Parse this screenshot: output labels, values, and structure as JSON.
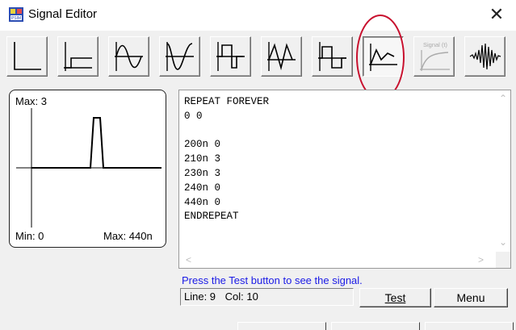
{
  "window": {
    "title": "Signal Editor",
    "close_glyph": "✕"
  },
  "toolbar": {
    "buttons": [
      {
        "icon": "step-icon",
        "pressed": false
      },
      {
        "icon": "offset-step-icon",
        "pressed": false
      },
      {
        "icon": "sine-icon",
        "pressed": false
      },
      {
        "icon": "cosine-icon",
        "pressed": false
      },
      {
        "icon": "square-pulse-icon",
        "pressed": false
      },
      {
        "icon": "triangle-icon",
        "pressed": false
      },
      {
        "icon": "square-wave-icon",
        "pressed": false
      },
      {
        "icon": "piecewise-linear-icon",
        "pressed": true
      },
      {
        "icon": "signal-t-icon",
        "pressed": false,
        "label": "Signal (t)"
      },
      {
        "icon": "noise-burst-icon",
        "pressed": false
      }
    ],
    "highlight_color": "#c8102e"
  },
  "preview": {
    "max_label": "Max: 3",
    "min_label": "Min: 0",
    "max_time_label": "Max: 440n"
  },
  "editor": {
    "lines": [
      "REPEAT FOREVER",
      "0 0",
      "",
      "200n 0",
      "210n 3",
      "230n 3",
      "240n 0",
      "440n 0",
      "ENDREPEAT"
    ]
  },
  "hint": "Press the Test button to see the signal.",
  "status": {
    "line": "Line: 9",
    "col": "Col: 10"
  },
  "buttons": {
    "test": "Test",
    "menu": "Menu"
  }
}
